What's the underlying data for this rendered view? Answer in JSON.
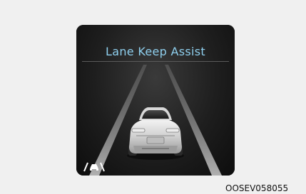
{
  "display": {
    "title": "Lane Keep Assist",
    "icon": "lane-keep-assist-icon",
    "colors": {
      "title": "#8fd0ef",
      "panel_background": "#111111",
      "lane_lines": "#8a8a8a"
    }
  },
  "caption": "OOSEV058055"
}
